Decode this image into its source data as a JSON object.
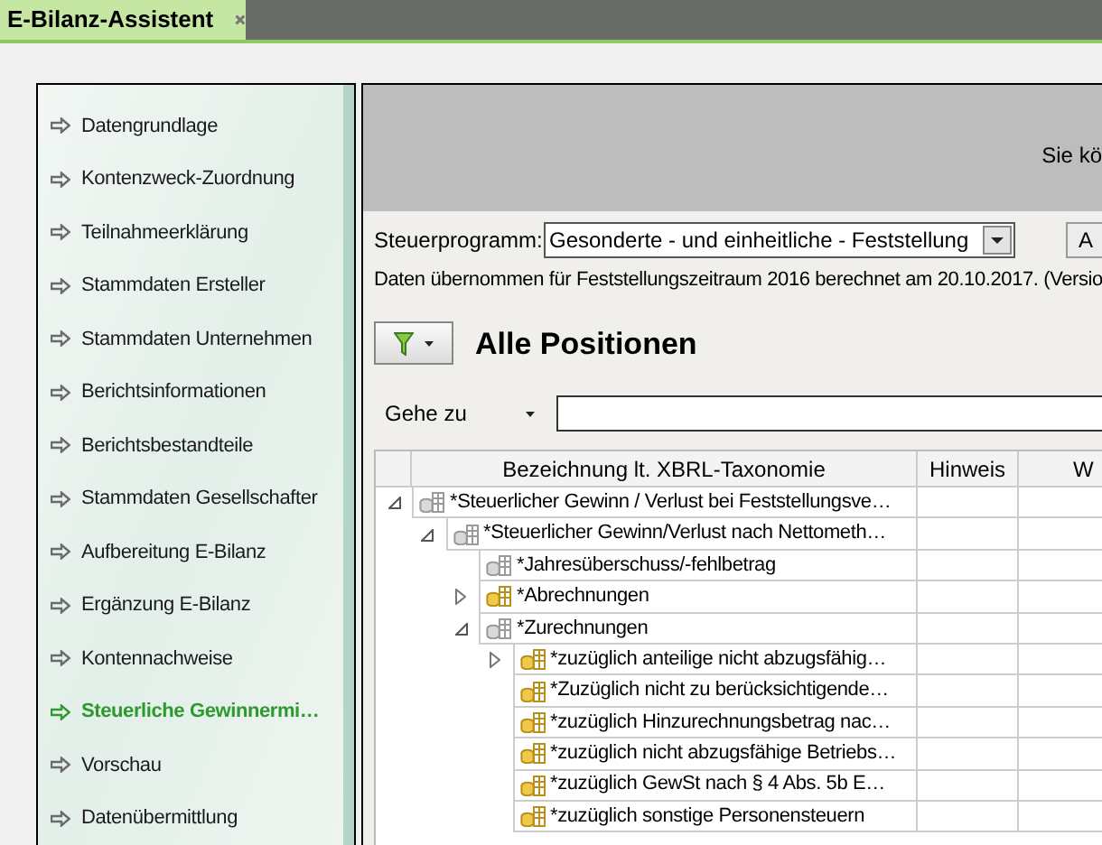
{
  "tab": {
    "title": "E-Bilanz-Assistent"
  },
  "sidebar": {
    "items": [
      {
        "label": "Datengrundlage",
        "selected": false
      },
      {
        "label": "Kontenzweck-Zuordnung",
        "selected": false
      },
      {
        "label": "Teilnahmeerklärung",
        "selected": false
      },
      {
        "label": "Stammdaten Ersteller",
        "selected": false
      },
      {
        "label": "Stammdaten Unternehmen",
        "selected": false
      },
      {
        "label": "Berichtsinformationen",
        "selected": false
      },
      {
        "label": "Berichtsbestandteile",
        "selected": false
      },
      {
        "label": "Stammdaten Gesellschafter",
        "selected": false
      },
      {
        "label": "Aufbereitung E-Bilanz",
        "selected": false
      },
      {
        "label": "Ergänzung E-Bilanz",
        "selected": false
      },
      {
        "label": "Kontennachweise",
        "selected": false
      },
      {
        "label": "Steuerliche Gewinnermi…",
        "selected": true
      },
      {
        "label": "Vorschau",
        "selected": false
      },
      {
        "label": "Datenübermittlung",
        "selected": false
      }
    ]
  },
  "header": {
    "notice": "Sie kö"
  },
  "steuerprogramm": {
    "label": "Steuerprogramm:",
    "value": "Gesonderte - und einheitliche - Feststellung",
    "button": "A"
  },
  "info": "Daten übernommen für Feststellungszeitraum 2016 berechnet am 20.10.2017. (Versio",
  "title": "Alle Positionen",
  "goto": {
    "label": "Gehe zu"
  },
  "table": {
    "columns": [
      "Bezeichnung lt. XBRL-Taxonomie",
      "Hinweis",
      "W"
    ],
    "rows": [
      {
        "label": "*Steuerlicher Gewinn / Verlust bei Feststellungsve…",
        "kind": "group",
        "expanded": true,
        "children": [
          {
            "label": "*Steuerlicher Gewinn/Verlust nach Nettometh…",
            "kind": "group",
            "expanded": true,
            "children": [
              {
                "label": "*Jahresüberschuss/-fehlbetrag",
                "kind": "group"
              },
              {
                "label": "*Abrechnungen",
                "kind": "position",
                "expanded": false
              },
              {
                "label": "*Zurechnungen",
                "kind": "group",
                "expanded": true,
                "children": [
                  {
                    "label": "*zuzüglich anteilige nicht abzugsfähig…",
                    "kind": "position",
                    "expanded": false
                  },
                  {
                    "label": "*Zuzüglich nicht zu berücksichtigende…",
                    "kind": "position"
                  },
                  {
                    "label": "*zuzüglich Hinzurechnungsbetrag nac…",
                    "kind": "position"
                  },
                  {
                    "label": "*zuzüglich nicht abzugsfähige Betriebs…",
                    "kind": "position"
                  },
                  {
                    "label": "*zuzüglich GewSt nach § 4 Abs. 5b E…",
                    "kind": "position"
                  },
                  {
                    "label": "*zuzüglich sonstige Personensteuern",
                    "kind": "position"
                  }
                ]
              }
            ]
          }
        ]
      }
    ]
  }
}
